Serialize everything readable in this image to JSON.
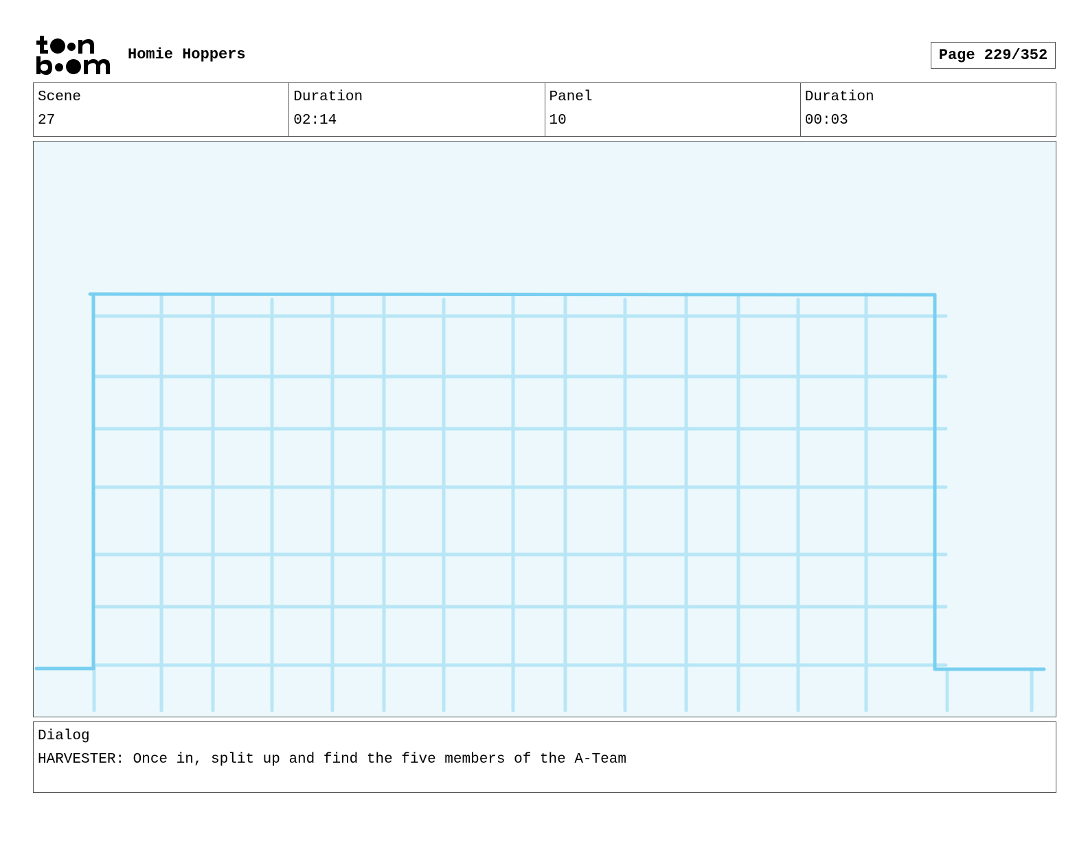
{
  "header": {
    "logo_text": "toon boom",
    "project_title": "Homie Hoppers",
    "page_label": "Page 229/352"
  },
  "info": [
    {
      "label": "Scene",
      "value": "27"
    },
    {
      "label": "Duration",
      "value": "02:14"
    },
    {
      "label": "Panel",
      "value": "10"
    },
    {
      "label": "Duration",
      "value": "00:03"
    }
  ],
  "panel": {
    "background_color": "#ecf8fb",
    "outline_color": "#79cff0",
    "grid_color": "#b8e6f6"
  },
  "dialog": {
    "label": "Dialog",
    "text": "HARVESTER: Once in, split up and find the five members of the A-Team"
  },
  "colors": {
    "border": "#555555",
    "text": "#000000"
  }
}
